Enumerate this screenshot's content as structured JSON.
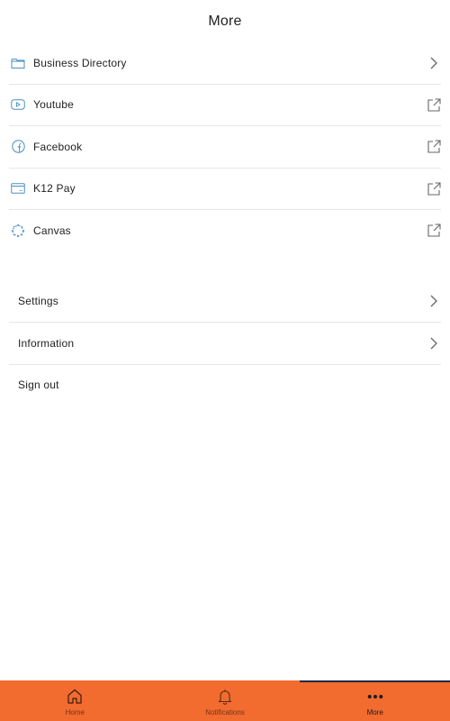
{
  "header": {
    "title": "More"
  },
  "links": [
    {
      "label": "Business Directory",
      "icon": "folder-icon",
      "trail": "chevron-right-icon"
    },
    {
      "label": "Youtube",
      "icon": "youtube-icon",
      "trail": "external-link-icon"
    },
    {
      "label": "Facebook",
      "icon": "facebook-icon",
      "trail": "external-link-icon"
    },
    {
      "label": "K12 Pay",
      "icon": "credit-card-icon",
      "trail": "external-link-icon"
    },
    {
      "label": "Canvas",
      "icon": "canvas-icon",
      "trail": "external-link-icon"
    }
  ],
  "settings": [
    {
      "label": "Settings",
      "trail": "chevron-right-icon"
    },
    {
      "label": "Information",
      "trail": "chevron-right-icon"
    },
    {
      "label": "Sign out"
    }
  ],
  "tabbar": {
    "tabs": [
      {
        "label": "Home",
        "icon": "home-icon",
        "active": false
      },
      {
        "label": "Notifications",
        "icon": "bell-icon",
        "active": false
      },
      {
        "label": "More",
        "icon": "more-dots-icon",
        "active": true
      }
    ]
  },
  "colors": {
    "accent": "#f26b2f",
    "icon_blue": "#4a8fc2",
    "indicator": "#1f2a44",
    "divider": "#e6e6e6"
  }
}
